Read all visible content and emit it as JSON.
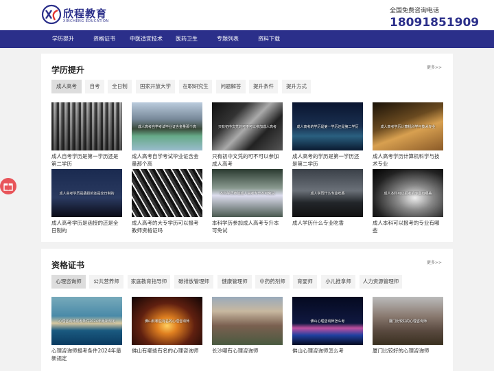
{
  "header": {
    "logo_text": "欣程教育",
    "logo_sub": "XINCHENG EDUCATION",
    "contact_label": "全国免费咨询电话",
    "contact_phone": "18091851909"
  },
  "nav": {
    "items": [
      "学历提升",
      "资格证书",
      "中医适宜技术",
      "医药卫生",
      "专题列表",
      "资料下载"
    ]
  },
  "section1": {
    "title": "学历提升",
    "more": "更多>>",
    "tabs": [
      "成人高考",
      "自考",
      "全日制",
      "国家开放大学",
      "在职研究生",
      "问题解答",
      "提升条件",
      "提升方式"
    ],
    "cards": [
      {
        "title": "成人自考学历是第一学历还是第二学历",
        "caption": ""
      },
      {
        "title": "成人高考自学考试毕业证含金量那个高",
        "caption": "成人高考自学考试毕业证含金量那个高"
      },
      {
        "title": "只有初中文凭的可不可以参加成人高考",
        "caption": "只有初中文凭的可不可以参加成人高考"
      },
      {
        "title": "成人高考的学历是第一学历还是第二学历",
        "caption": "成人高考的学历是第一学历还是第二学历"
      },
      {
        "title": "成人高考学历计算机科学与技术专业",
        "caption": "成人高考学历计算机科学与技术专业"
      },
      {
        "title": "成人高考学历是函授的还是全日制的",
        "caption": "成人高考学历是函授的还是全日制的"
      },
      {
        "title": "成人高考的大专学历可以报考教师资格证吗",
        "caption": ""
      },
      {
        "title": "本科学历参加成人高考专升本可免试",
        "caption": "本科学历参加成人高考专升本可免试"
      },
      {
        "title": "成人学历什么专业吃香",
        "caption": "成人学历什么专业吃香"
      },
      {
        "title": "成人本科可以报考的专业有哪些",
        "caption": "成人本科可以报考的专业有哪些"
      }
    ]
  },
  "section2": {
    "title": "资格证书",
    "more": "更多>>",
    "tabs": [
      "心理咨询师",
      "公共营养师",
      "家庭教育指导师",
      "碳排放管理师",
      "健康管理师",
      "中药药剂师",
      "育婴师",
      "小儿推拿师",
      "人力资源管理师"
    ],
    "cards": [
      {
        "title": "心理咨询师报考条件2024年最新规定",
        "caption": "心理咨询师报考条件2024年最新规定"
      },
      {
        "title": "佛山有哪些有名的心理咨询师",
        "caption": "佛山有哪些有名的心理咨询师"
      },
      {
        "title": "长沙哪有心理咨询师",
        "caption": ""
      },
      {
        "title": "佛山心理咨询师怎么考",
        "caption": "佛山心理咨询师怎么考"
      },
      {
        "title": "厦门比较好的心理咨询师",
        "caption": "厦门比较好的心理咨询师"
      }
    ]
  }
}
